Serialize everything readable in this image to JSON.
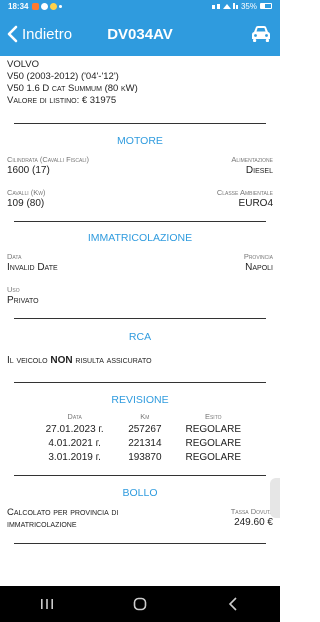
{
  "status_bar": {
    "time": "18:34",
    "battery": "35%",
    "notification_icons": [
      "app-notification-icon",
      "facebook-icon",
      "heart-icon",
      "dot-icon"
    ],
    "status_icons": [
      "nfc-icon",
      "bluetooth-icon",
      "wifi-icon",
      "volte-icon",
      "signal-icon",
      "battery-icon"
    ]
  },
  "header": {
    "back_label": "Indietro",
    "plate": "DV034AV",
    "action_icon": "car-icon",
    "colors": {
      "primary": "#2f9bde"
    }
  },
  "vehicle": {
    "make": "VOLVO",
    "model": "V50 (2003-2012) ('04'-'12')",
    "version": "V50 1.6 D cat Summum (80 kW)",
    "list_price": "Valore di listino: € 31975"
  },
  "motore": {
    "title": "MOTORE",
    "displacement_label": "Cilindrata (Cavalli Fiscali)",
    "displacement_value": "1600 (17)",
    "fuel_label": "Alimentazione",
    "fuel_value": "Diesel",
    "power_label": "Cavalli (Kw)",
    "power_value": "109 (80)",
    "env_label": "Classe Ambientale",
    "env_value": "EURO4"
  },
  "immatricolazione": {
    "title": "IMMATRICOLAZIONE",
    "date_label": "Data",
    "date_value": "Invalid Date",
    "province_label": "Provincia",
    "province_value": "Napoli",
    "use_label": "Uso",
    "use_value": "Privato"
  },
  "rca": {
    "title": "RCA",
    "text_before": "Il veicolo ",
    "text_bold": "NON",
    "text_after": " risulta assicurato"
  },
  "revisione": {
    "title": "REVISIONE",
    "headers": {
      "date": "Data",
      "km": "Km",
      "result": "Esito"
    },
    "rows": [
      {
        "date": "27.01.2023 г.",
        "km": "257267",
        "result": "REGOLARE"
      },
      {
        "date": "4.01.2021 г.",
        "km": "221314",
        "result": "REGOLARE"
      },
      {
        "date": "3.01.2019 г.",
        "km": "193870",
        "result": "REGOLARE"
      }
    ]
  },
  "bollo": {
    "title": "BOLLO",
    "description": "Calcolato per provincia di immatricolazione",
    "tax_label": "Tassa Dovuta",
    "tax_value": "249.60 €"
  },
  "nav_bar": {
    "icons": [
      "recent-apps-icon",
      "home-icon",
      "back-icon"
    ]
  }
}
